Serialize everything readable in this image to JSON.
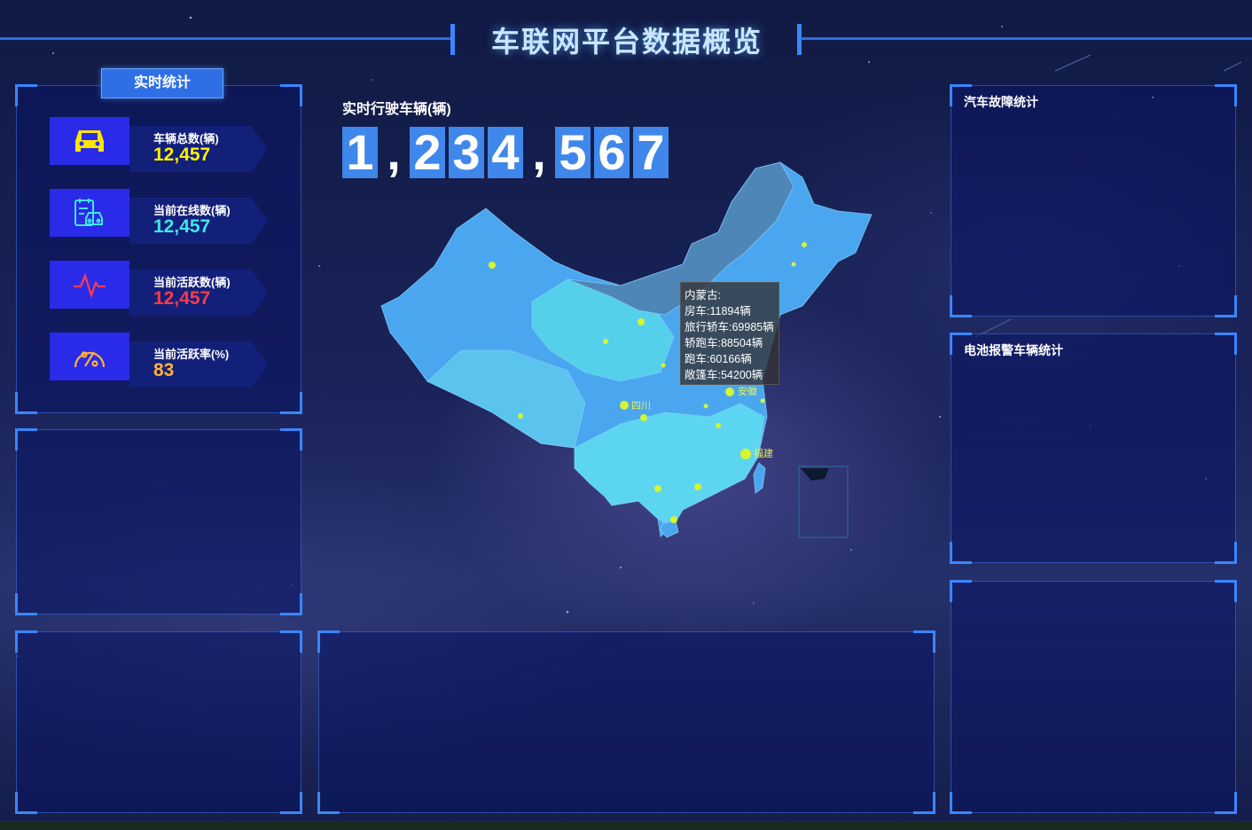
{
  "header": {
    "title": "车联网平台数据概览"
  },
  "realtime": {
    "badge": "实时统计",
    "stats": [
      {
        "label": "车辆总数(辆)",
        "value": "12,457",
        "color": "#fff200",
        "icon": "car-icon"
      },
      {
        "label": "当前在线数(辆)",
        "value": "12,457",
        "color": "#3fe6e6",
        "icon": "clipboard-car-icon"
      },
      {
        "label": "当前活跃数(辆)",
        "value": "12,457",
        "color": "#ff3b4a",
        "icon": "pulse-icon"
      },
      {
        "label": "当前活跃率(%)",
        "value": "83",
        "color": "#ffb13b",
        "icon": "percent-gauge-icon"
      }
    ]
  },
  "running": {
    "label": "实时行驶车辆(辆)",
    "digits": [
      "1",
      ",",
      "2",
      "3",
      "4",
      ",",
      "5",
      "6",
      "7"
    ]
  },
  "map": {
    "tooltip": {
      "title": "内蒙古:",
      "lines": [
        "房车:11894辆",
        "旅行轿车:69985辆",
        "轿跑车:88504辆",
        "跑车:60166辆",
        "敞篷车:54200辆"
      ]
    },
    "labels": [
      "四川",
      "安徽",
      "福建"
    ],
    "colors": {
      "region": "#4aa6ef",
      "region_light": "#5cd6f0",
      "highlight": "#4f86b8",
      "point": "#d7f432"
    }
  },
  "panels": {
    "fault_title": "汽车故障统计",
    "battery_title": "电池报警车辆统计"
  }
}
